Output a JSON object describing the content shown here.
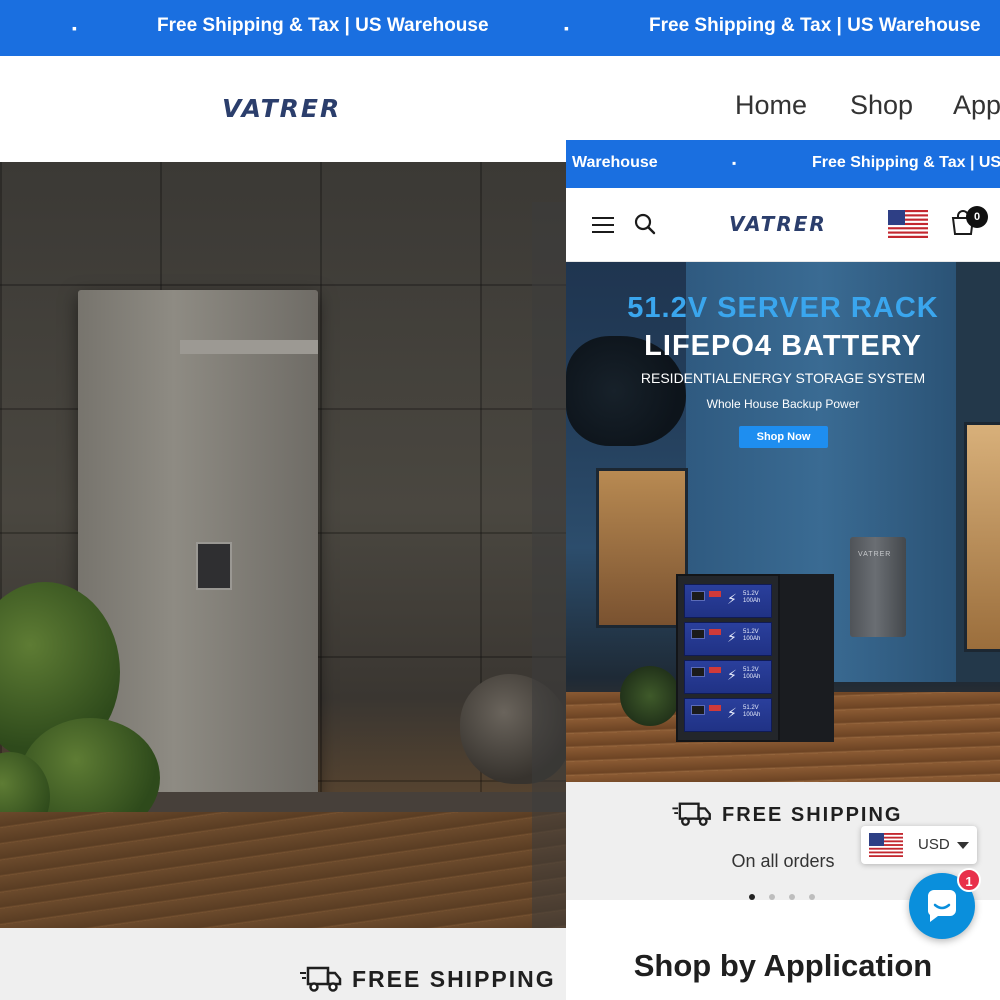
{
  "background_page": {
    "announcement": {
      "messages": [
        "Free Shipping & Tax | US Warehouse",
        "Free Shipping & Tax | US Warehouse"
      ],
      "separator": "▪"
    },
    "header": {
      "logo": "VATRER",
      "nav": [
        "Home",
        "Shop",
        "App"
      ]
    },
    "usp": {
      "title": "FREE SHIPPING",
      "icon": "truck-icon"
    }
  },
  "mobile_page": {
    "announcement": {
      "left_text": "Warehouse",
      "separator": "▪",
      "right_text": "Free Shipping & Tax | US"
    },
    "header": {
      "menu_icon": "hamburger-icon",
      "search_icon": "search-icon",
      "logo": "VATRER",
      "flag_icon": "us-flag-icon",
      "cart_icon": "cart-icon",
      "cart_count": "0"
    },
    "hero": {
      "headline_1": "51.2V SERVER RACK",
      "headline_2": "LIFEPO4 BATTERY",
      "subtitle": "RESIDENTIALENERGY STORAGE SYSTEM",
      "tagline": "Whole House Backup Power",
      "cta": "Shop Now",
      "wall_unit_label": "VATRER",
      "module_label": "51.2V 100Ah"
    },
    "usp": {
      "title": "FREE SHIPPING",
      "subtitle": "On all orders",
      "slides": 4,
      "active_slide": 1
    },
    "section": {
      "title": "Shop by Application"
    }
  },
  "currency_selector": {
    "code": "USD",
    "flag_icon": "us-flag-icon"
  },
  "chat": {
    "icon": "chat-icon",
    "badge": "1"
  },
  "colors": {
    "brand_blue": "#1a6fe0",
    "logo_navy": "#2b3e6c",
    "hero_accent": "#3aa6ee",
    "cta_blue": "#1e8ef0",
    "chat_blue": "#0a8fdc",
    "badge_red": "#e8304b"
  }
}
